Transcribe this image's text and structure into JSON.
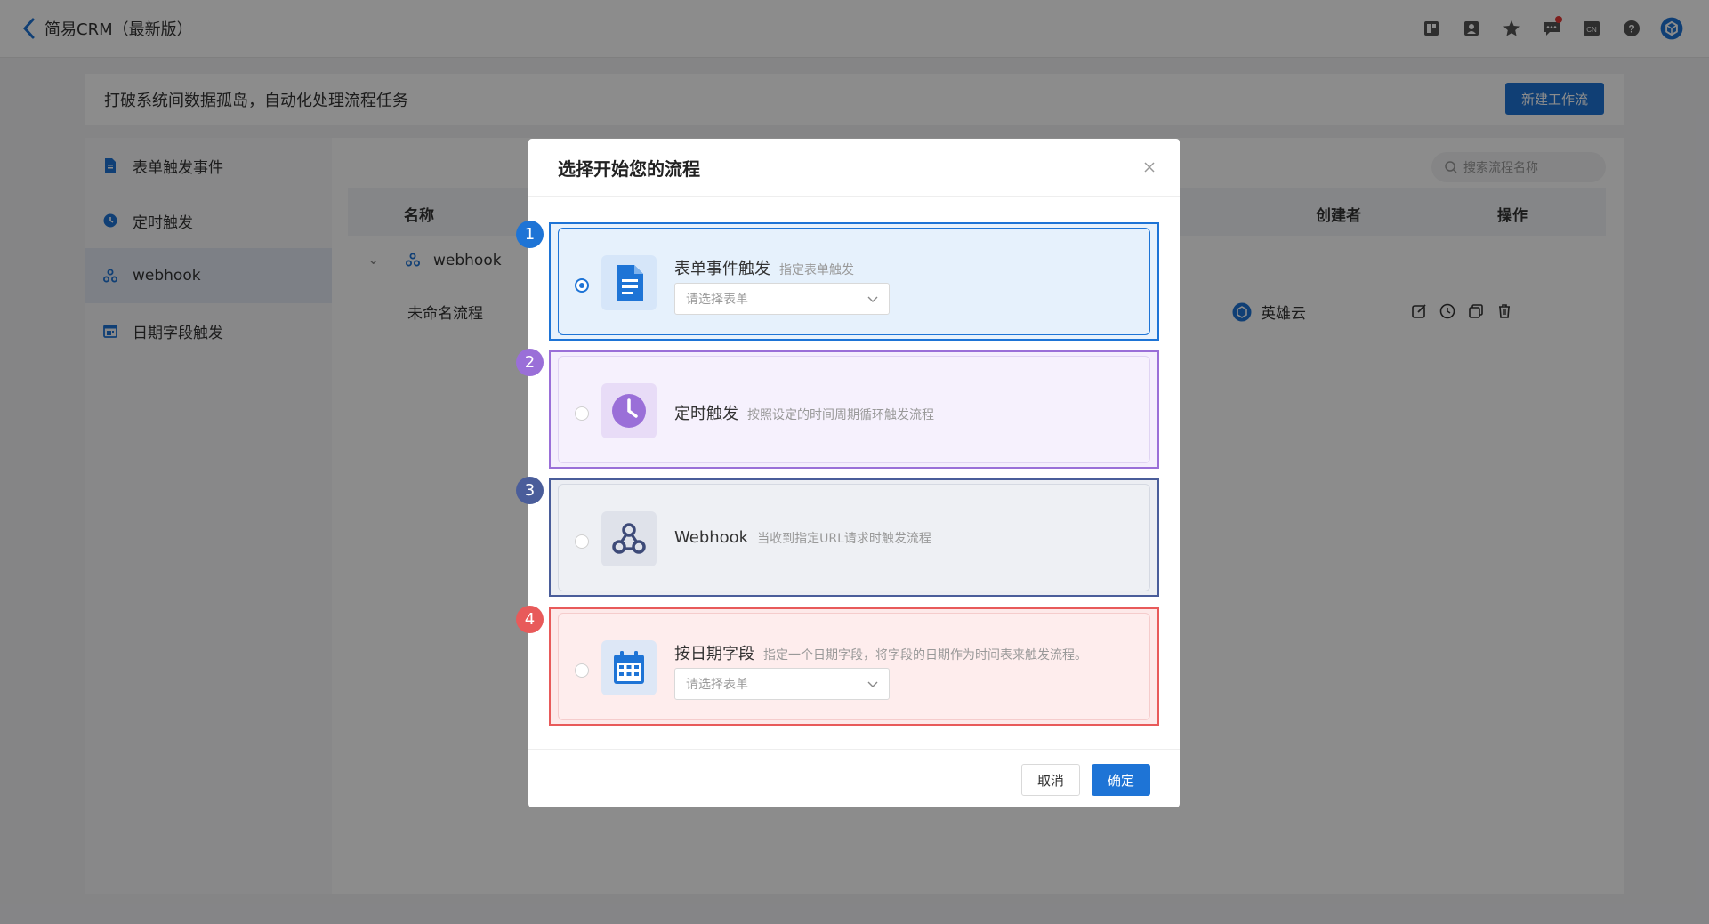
{
  "header": {
    "app_title": "简易CRM（最新版）",
    "icons": [
      "layout-icon",
      "contacts-icon",
      "star-icon",
      "message-icon",
      "language-cn-icon",
      "help-icon",
      "avatar-icon"
    ],
    "cn_label": "CN"
  },
  "banner": {
    "text": "打破系统间数据孤岛，自动化处理流程任务",
    "new_button": "新建工作流"
  },
  "sidebar": {
    "items": [
      {
        "label": "表单触发事件",
        "icon": "document-icon"
      },
      {
        "label": "定时触发",
        "icon": "clock-icon"
      },
      {
        "label": "webhook",
        "icon": "webhook-icon"
      },
      {
        "label": "日期字段触发",
        "icon": "calendar-icon"
      }
    ],
    "active_index": 2
  },
  "search": {
    "placeholder": "搜索流程名称"
  },
  "table": {
    "columns": {
      "name": "名称",
      "creator": "创建者",
      "actions": "操作"
    },
    "group_label": "webhook",
    "rows": [
      {
        "name": "未命名流程",
        "creator": "英雄云"
      }
    ]
  },
  "dialog": {
    "title": "选择开始您的流程",
    "options": [
      {
        "badge": "1",
        "title": "表单事件触发",
        "desc": "指定表单触发",
        "select_placeholder": "请选择表单",
        "checked": true,
        "color": "#1e74d6"
      },
      {
        "badge": "2",
        "title": "定时触发",
        "desc": "按照设定的时间周期循环触发流程",
        "checked": false,
        "color": "#9a6fd8"
      },
      {
        "badge": "3",
        "title": "Webhook",
        "desc": "当收到指定URL请求时触发流程",
        "checked": false,
        "color": "#4a5d9a"
      },
      {
        "badge": "4",
        "title": "按日期字段",
        "desc": "指定一个日期字段，将字段的日期作为时间表来触发流程。",
        "select_placeholder": "请选择表单",
        "checked": false,
        "color": "#e85a5a"
      }
    ],
    "cancel_label": "取消",
    "ok_label": "确定"
  }
}
